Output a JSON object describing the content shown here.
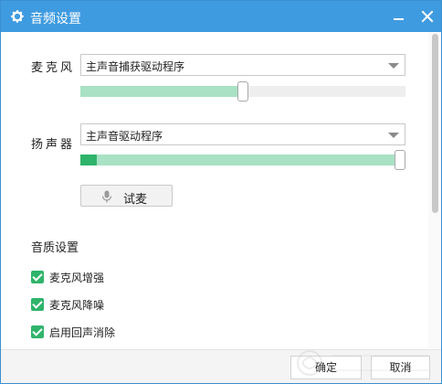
{
  "window": {
    "title": "音频设置",
    "icon": "gear-icon"
  },
  "microphone": {
    "label": "麦克风",
    "device": "主声音捕获驱动程序",
    "level": 0.5
  },
  "speaker": {
    "label": "扬声器",
    "device": "主声音驱动程序",
    "level": 1.0,
    "meter": 0.05
  },
  "test_button": {
    "label": "试麦",
    "icon": "microphone-icon"
  },
  "quality": {
    "title": "音质设置",
    "options": [
      {
        "label": "麦克风增强",
        "checked": true
      },
      {
        "label": "麦克风降噪",
        "checked": true
      },
      {
        "label": "启用回声消除",
        "checked": true
      }
    ]
  },
  "footer": {
    "ok_label": "确定",
    "cancel_label": "取消"
  },
  "colors": {
    "titlebar": "#3f9be0",
    "accent": "#2fb46b",
    "slider_fill": "#a8e1c4"
  }
}
